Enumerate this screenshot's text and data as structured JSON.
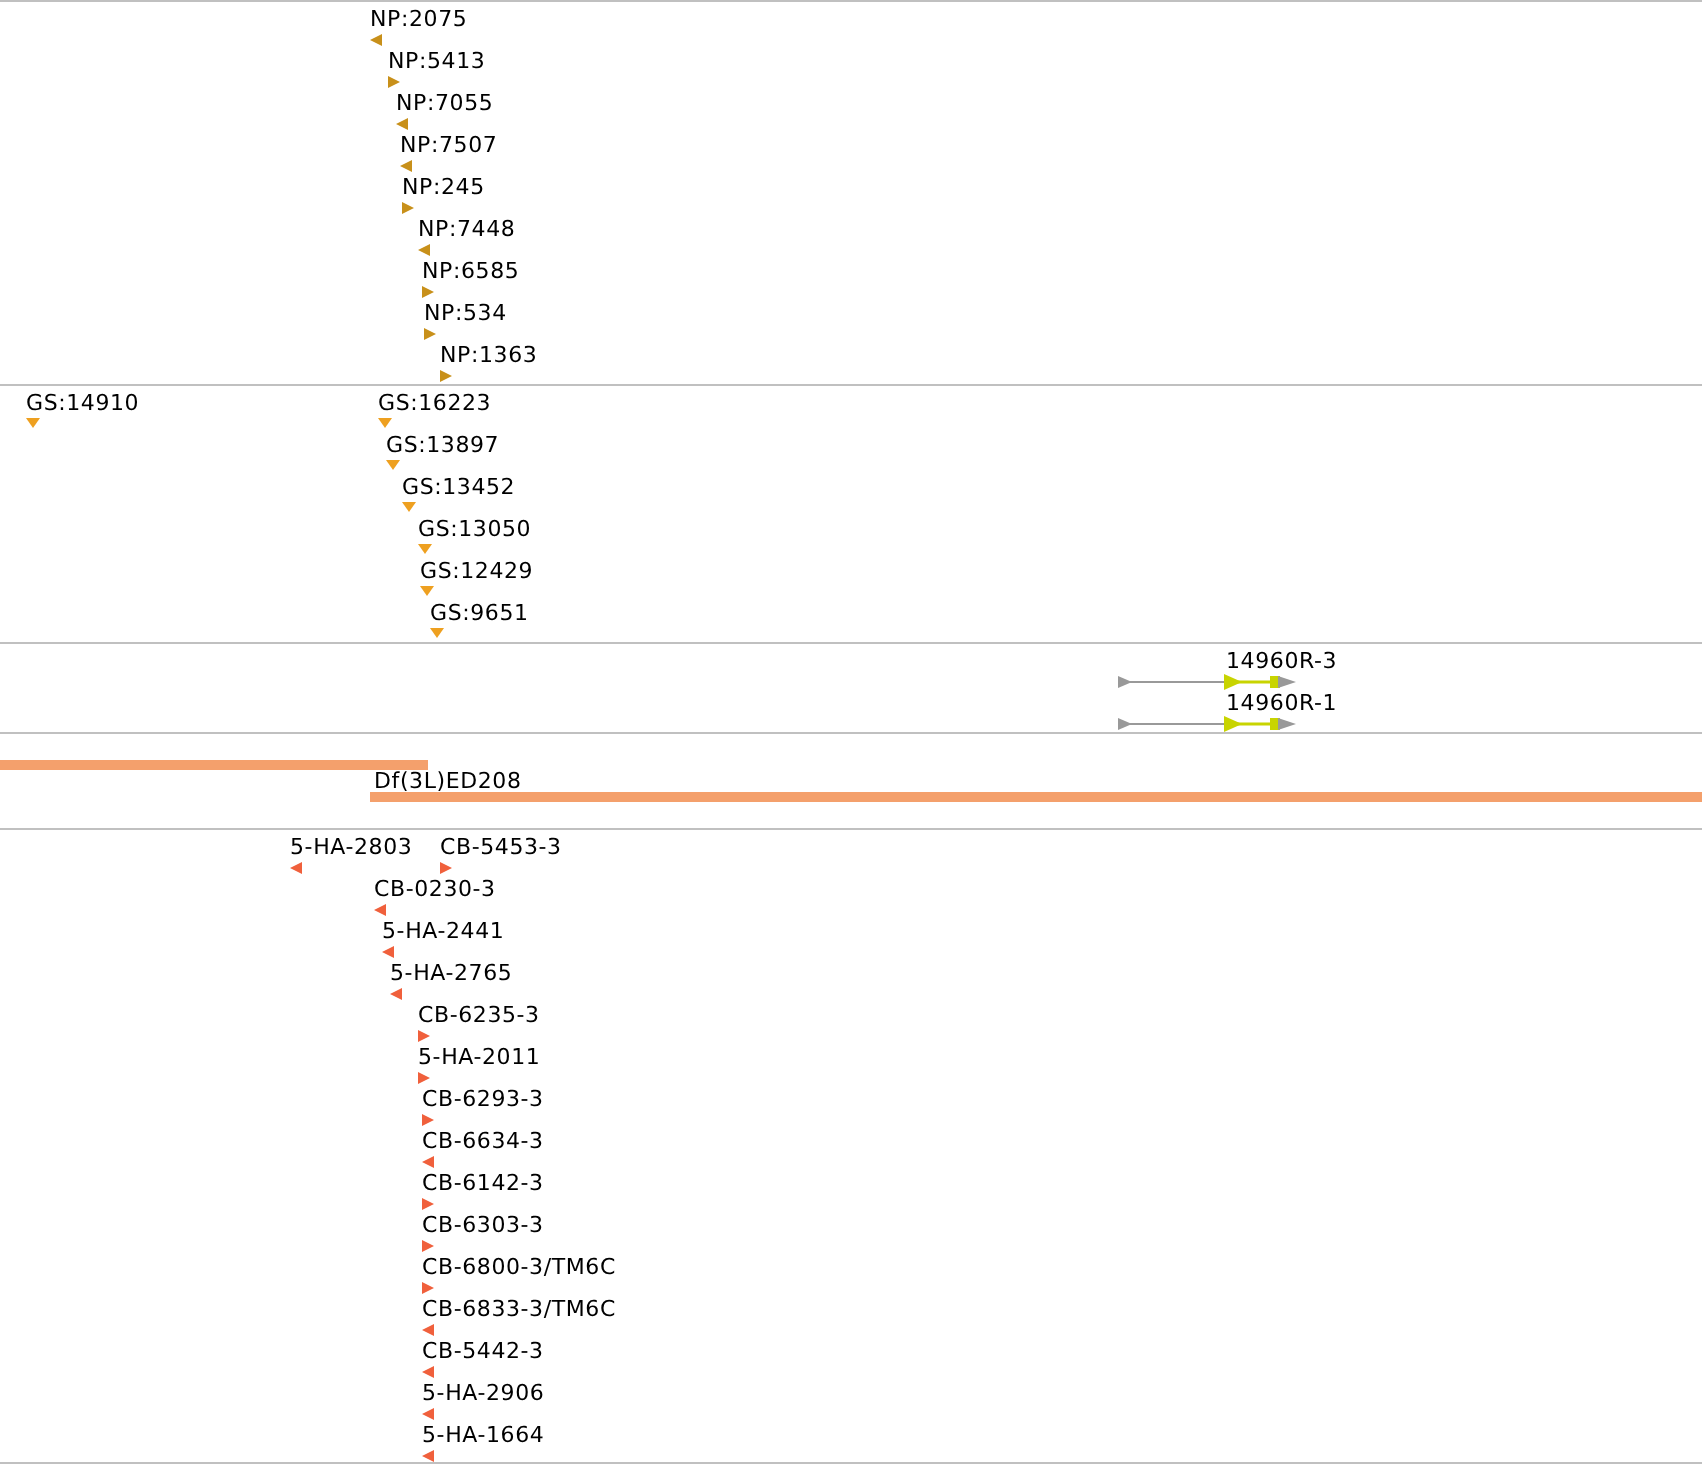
{
  "tracks": [
    {
      "kind": "point",
      "color": "#c8901a",
      "rows": [
        {
          "features": [
            {
              "label": "NP:2075",
              "kind": "reverse"
            }
          ]
        },
        {
          "features": [
            {
              "label": "NP:5413",
              "kind": "forward"
            }
          ]
        },
        {
          "features": [
            {
              "label": "NP:7055",
              "kind": "reverse"
            }
          ]
        },
        {
          "features": [
            {
              "label": "NP:7507",
              "kind": "reverse"
            }
          ]
        },
        {
          "features": [
            {
              "label": "NP:245",
              "kind": "forward"
            }
          ]
        },
        {
          "features": [
            {
              "label": "NP:7448",
              "kind": "reverse"
            }
          ]
        },
        {
          "features": [
            {
              "label": "NP:6585",
              "kind": "forward"
            }
          ]
        },
        {
          "features": [
            {
              "label": "NP:534",
              "kind": "forward"
            }
          ]
        },
        {
          "features": [
            {
              "label": "NP:1363",
              "kind": "forward"
            }
          ]
        }
      ]
    },
    {
      "kind": "point",
      "color": "#eea020",
      "rows": [
        {
          "features": [
            {
              "label": "GS:14910",
              "kind": "unknown"
            },
            {
              "label": "GS:16223",
              "kind": "unknown"
            }
          ]
        },
        {
          "features": [
            {
              "label": "GS:13897",
              "kind": "unknown"
            }
          ]
        },
        {
          "features": [
            {
              "label": "GS:13452",
              "kind": "unknown"
            }
          ]
        },
        {
          "features": [
            {
              "label": "GS:13050",
              "kind": "unknown"
            }
          ]
        },
        {
          "features": [
            {
              "label": "GS:12429",
              "kind": "unknown"
            }
          ]
        },
        {
          "features": [
            {
              "label": "GS:9651",
              "kind": "unknown"
            }
          ]
        }
      ]
    },
    {
      "kind": "gene",
      "color": "#c8d400",
      "rows": [
        {
          "features": [
            {
              "label": "14960R-3"
            }
          ]
        },
        {
          "features": [
            {
              "label": "14960R-1"
            }
          ]
        }
      ]
    },
    {
      "kind": "deficiency",
      "color": "#f4a06c",
      "rows": [
        {
          "features": [
            {
              "kind": "bar"
            }
          ]
        },
        {
          "features": [
            {
              "kind": "bar",
              "label": "Df(3L)ED208"
            }
          ]
        }
      ]
    },
    {
      "kind": "point",
      "color": "#f0603c",
      "rows": [
        {
          "features": [
            {
              "label": "5-HA-2803",
              "kind": "reverse"
            },
            {
              "label": "CB-5453-3",
              "kind": "forward"
            }
          ]
        },
        {
          "features": [
            {
              "label": "CB-0230-3",
              "kind": "reverse"
            }
          ]
        },
        {
          "features": [
            {
              "label": "5-HA-2441",
              "kind": "reverse"
            }
          ]
        },
        {
          "features": [
            {
              "label": "5-HA-2765",
              "kind": "reverse"
            }
          ]
        },
        {
          "features": [
            {
              "label": "CB-6235-3",
              "kind": "forward"
            }
          ]
        },
        {
          "features": [
            {
              "label": "5-HA-2011",
              "kind": "forward"
            }
          ]
        },
        {
          "features": [
            {
              "label": "CB-6293-3",
              "kind": "forward"
            }
          ]
        },
        {
          "features": [
            {
              "label": "CB-6634-3",
              "kind": "reverse"
            }
          ]
        },
        {
          "features": [
            {
              "label": "CB-6142-3",
              "kind": "forward"
            }
          ]
        },
        {
          "features": [
            {
              "label": "CB-6303-3",
              "kind": "forward"
            }
          ]
        },
        {
          "features": [
            {
              "label": "CB-6800-3/TM6C",
              "kind": "forward"
            }
          ]
        },
        {
          "features": [
            {
              "label": "CB-6833-3/TM6C",
              "kind": "reverse"
            }
          ]
        },
        {
          "features": [
            {
              "label": "CB-5442-3",
              "kind": "reverse"
            }
          ]
        },
        {
          "features": [
            {
              "label": "5-HA-2906",
              "kind": "reverse"
            }
          ]
        },
        {
          "features": [
            {
              "label": "5-HA-1664",
              "kind": "reverse"
            }
          ]
        }
      ]
    }
  ]
}
